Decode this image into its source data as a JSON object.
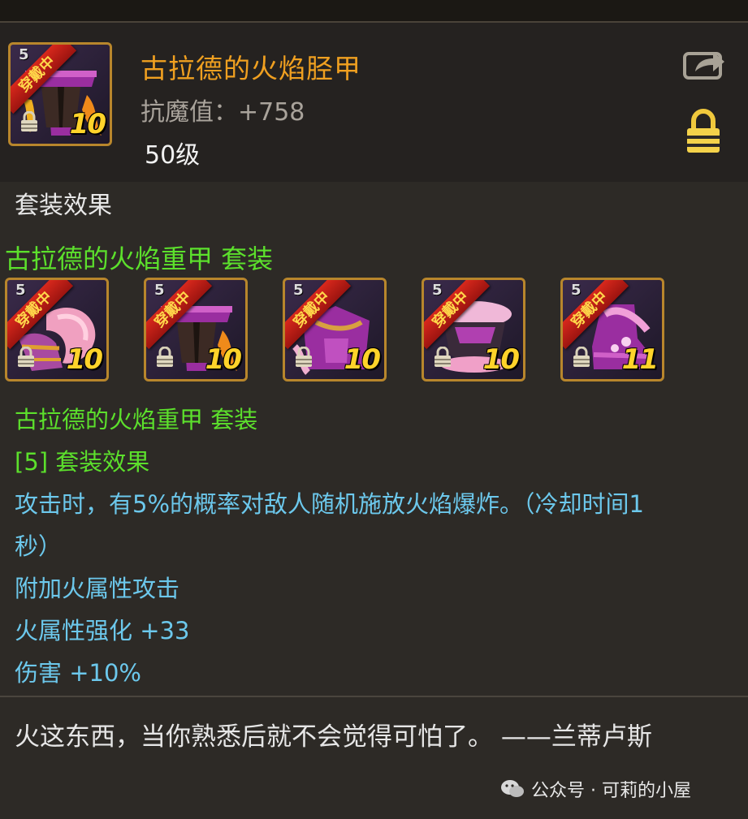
{
  "item": {
    "level_badge": "5",
    "equipped_badge": "穿戴中",
    "enhance": "10",
    "name": "古拉德的火焰胫甲",
    "stat": "抗魔值：+758",
    "level": "50级"
  },
  "set_effects_label": "套装效果",
  "set": {
    "title": "古拉德的火焰重甲  套装",
    "pieces": [
      {
        "slot": "shoulder",
        "level_badge": "5",
        "equipped_badge": "穿戴中",
        "enhance": "10",
        "icon": "flame-shoulder-icon"
      },
      {
        "slot": "pants",
        "level_badge": "5",
        "equipped_badge": "穿戴中",
        "enhance": "10",
        "icon": "flame-pants-icon"
      },
      {
        "slot": "chest",
        "level_badge": "5",
        "equipped_badge": "穿戴中",
        "enhance": "10",
        "icon": "flame-chest-icon"
      },
      {
        "slot": "belt",
        "level_badge": "5",
        "equipped_badge": "穿戴中",
        "enhance": "10",
        "icon": "flame-belt-icon"
      },
      {
        "slot": "shoes",
        "level_badge": "5",
        "equipped_badge": "穿戴中",
        "enhance": "11",
        "icon": "flame-shoes-icon"
      }
    ],
    "detail_title": "古拉德的火焰重甲 套装",
    "tier_label": "[5] 套装效果",
    "effect_lines": [
      "攻击时，有5%的概率对敌人随机施放火焰爆炸。（冷却时间1",
      "秒）",
      "附加火属性攻击",
      "火属性强化 +33",
      "伤害 +10%"
    ]
  },
  "flavor_text": "火这东西，当你熟悉后就不会觉得可怕了。 ——兰蒂卢斯",
  "watermark": "公众号 · 可莉的小屋",
  "colors": {
    "title": "#f0a020",
    "set_green": "#5ce02c",
    "effect_blue": "#6cc8ec",
    "frame_gold": "#b8862c"
  }
}
